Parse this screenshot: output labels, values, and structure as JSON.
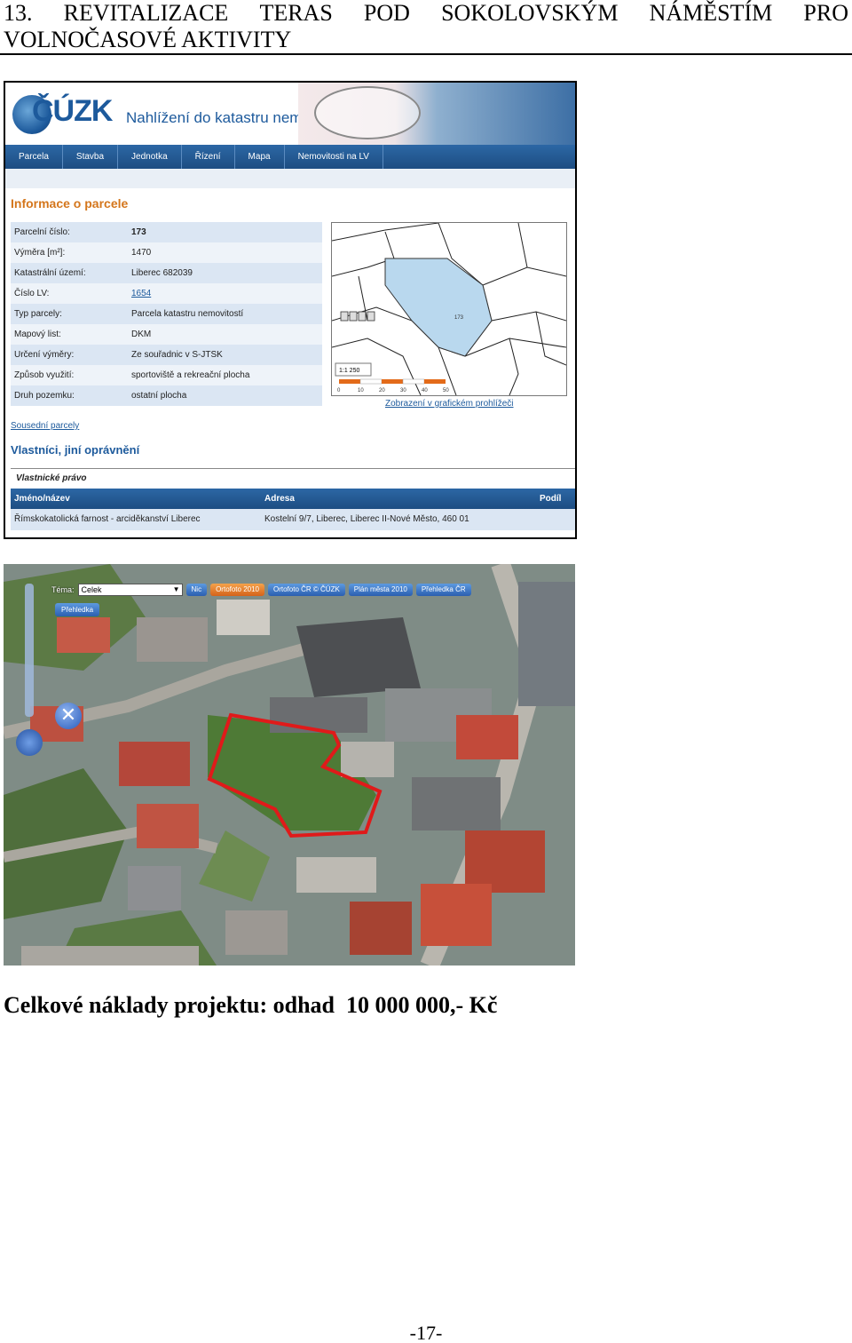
{
  "heading": {
    "words_line1": [
      "13.",
      "REVITALIZACE",
      "TERAS",
      "POD",
      "SOKOLOVSKÝM",
      "NÁMĚSTÍM",
      "PRO"
    ],
    "line2": "VOLNOČASOVÉ AKTIVITY"
  },
  "cuzk": {
    "logo_text": "ČÚZK",
    "subtitle": "Nahlížení do katastru nemovitostí",
    "nav": [
      "Parcela",
      "Stavba",
      "Jednotka",
      "Řízení",
      "Mapa",
      "Nemovitosti na LV"
    ],
    "info_heading": "Informace o parcele",
    "info_rows": [
      {
        "label": "Parcelní číslo:",
        "value": "173"
      },
      {
        "label": "Výměra [m²]:",
        "value": "1470"
      },
      {
        "label": "Katastrální území:",
        "value": "Liberec 682039"
      },
      {
        "label": "Číslo LV:",
        "value": "1654"
      },
      {
        "label": "Typ parcely:",
        "value": "Parcela katastru nemovitostí"
      },
      {
        "label": "Mapový list:",
        "value": "DKM"
      },
      {
        "label": "Určení výměry:",
        "value": "Ze souřadnic v S-JTSK"
      },
      {
        "label": "Způsob využití:",
        "value": "sportoviště a rekreační plocha"
      },
      {
        "label": "Druh pozemku:",
        "value": "ostatní plocha"
      }
    ],
    "map": {
      "scale": "1:1 250",
      "parcel_number": "173",
      "scale_ticks": [
        "0",
        "10",
        "20",
        "30",
        "40",
        "50"
      ]
    },
    "map_link": "Zobrazení v grafickém prohlížeči",
    "neighbors_link": "Sousední parcely",
    "owners_heading": "Vlastníci, jiní oprávnění",
    "owners": {
      "caption": "Vlastnické právo",
      "headers": {
        "name": "Jméno/název",
        "address": "Adresa",
        "share": "Podíl"
      },
      "rows": [
        {
          "name": "Římskokatolická farnost - arciděkanství Liberec",
          "address": "Kostelní 9/7, Liberec, Liberec II-Nové Město, 460 01",
          "share": ""
        }
      ]
    }
  },
  "aerial": {
    "tema_label": "Téma:",
    "tema_value": "Celek",
    "buttons": [
      "Nic",
      "Ortofoto 2010",
      "Ortofoto ČR © ČÚZK",
      "Plán města 2010",
      "Přehledka ČR"
    ],
    "active_button_index": 1,
    "prehled_button": "Přehledka",
    "colors": {
      "outline": "#e01a1a"
    }
  },
  "cost_line": "Celkové náklady projektu: odhad  10 000 000,- Kč",
  "page_number": "-17-"
}
